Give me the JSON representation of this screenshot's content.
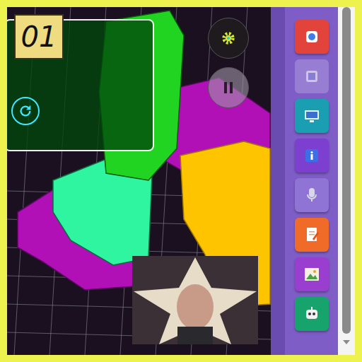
{
  "level_badge": "01",
  "sidebar": {
    "items": [
      {
        "color": "#e2433a",
        "disabled": false
      },
      {
        "color": "#a08ad8",
        "disabled": true
      },
      {
        "color": "#1a9fb2",
        "disabled": false
      },
      {
        "color": "#7c3fd0",
        "disabled": false
      },
      {
        "color": "#8f74d6",
        "disabled": false
      },
      {
        "color": "#f06a28",
        "disabled": false
      },
      {
        "color": "#9a3ed0",
        "disabled": false
      },
      {
        "color": "#17a46c",
        "disabled": false
      }
    ]
  }
}
